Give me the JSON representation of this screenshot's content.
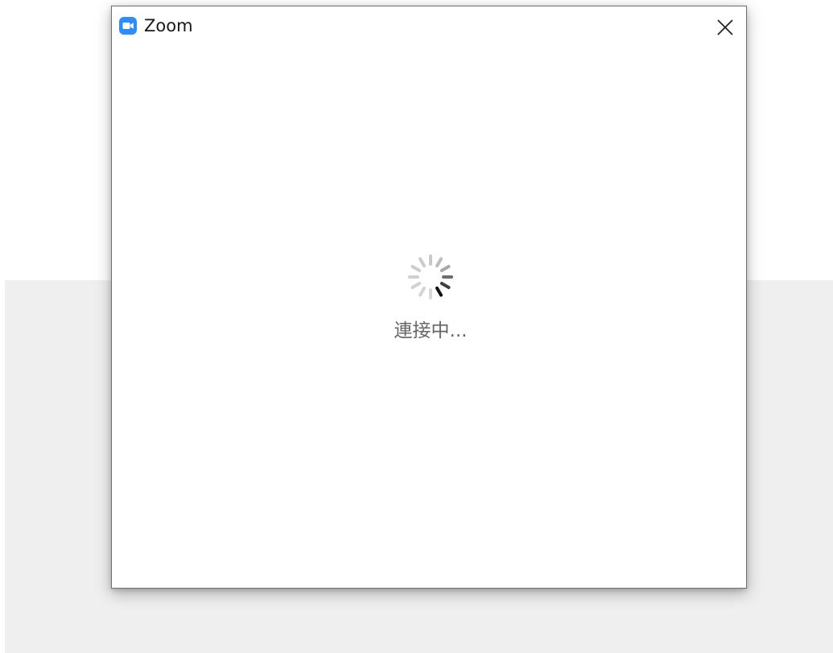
{
  "window": {
    "title": "Zoom",
    "close_icon": "close-icon",
    "app_icon": "zoom-camera-icon"
  },
  "content": {
    "status_text": "連接中...",
    "spinner_icon": "loading-spinner-icon"
  },
  "colors": {
    "brand": "#2d8cff",
    "status_text": "#666666",
    "page_background_lower": "#efefef"
  }
}
